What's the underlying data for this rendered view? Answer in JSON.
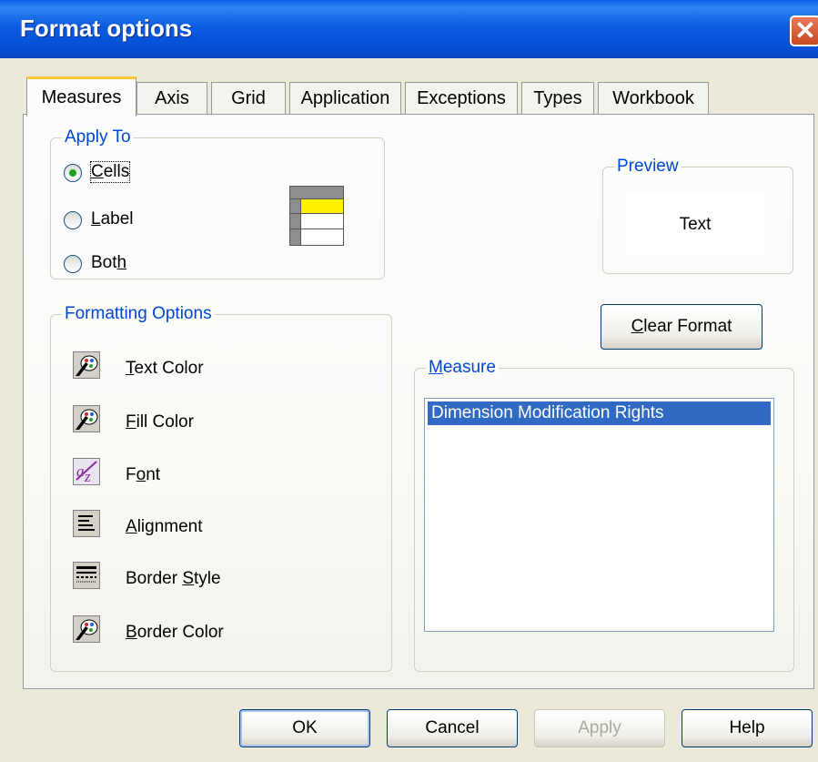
{
  "window": {
    "title": "Format options",
    "close_glyph": "✕"
  },
  "tabs": [
    {
      "label": "Measures",
      "active": true
    },
    {
      "label": "Axis"
    },
    {
      "label": "Grid"
    },
    {
      "label": "Application"
    },
    {
      "label": "Exceptions"
    },
    {
      "label": "Types"
    },
    {
      "label": "Workbook"
    }
  ],
  "apply_to": {
    "legend": "Apply To",
    "options": [
      {
        "pre": "",
        "ul": "C",
        "post": "ells",
        "checked": true
      },
      {
        "pre": "",
        "ul": "L",
        "post": "abel",
        "checked": false
      },
      {
        "pre": "Bot",
        "ul": "h",
        "post": "",
        "checked": false
      }
    ],
    "icon": "cell-grid-icon"
  },
  "preview": {
    "legend": "Preview",
    "text": "Text"
  },
  "clear_format": {
    "pre": "",
    "ul": "C",
    "post": "lear Format"
  },
  "formatting": {
    "legend": "Formatting Options",
    "items": [
      {
        "pre": "",
        "ul": "T",
        "post": "ext Color",
        "icon": "palette-icon"
      },
      {
        "pre": "",
        "ul": "F",
        "post": "ill Color",
        "icon": "palette-icon"
      },
      {
        "pre": "F",
        "ul": "o",
        "post": "nt",
        "icon": "font-icon"
      },
      {
        "pre": "",
        "ul": "A",
        "post": "lignment",
        "icon": "alignment-icon"
      },
      {
        "pre": "Border ",
        "ul": "S",
        "post": "tyle",
        "icon": "border-style-icon"
      },
      {
        "pre": "",
        "ul": "B",
        "post": "order Color",
        "icon": "palette-icon"
      }
    ]
  },
  "measure": {
    "legend_ul": "M",
    "legend_post": "easure",
    "items": [
      {
        "label": "Dimension Modification Rights",
        "selected": true
      }
    ]
  },
  "buttons": {
    "ok": "OK",
    "cancel": "Cancel",
    "apply": "Apply",
    "help": "Help"
  },
  "colors": {
    "titlebar": "#0551D8",
    "legend_text": "#0046D5",
    "selection": "#316AC5",
    "active_tab_accent": "#FFC83C"
  }
}
